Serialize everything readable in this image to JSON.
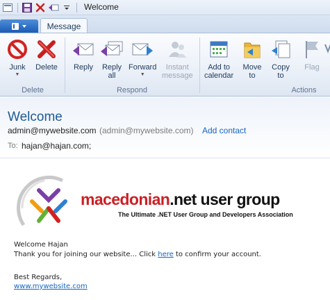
{
  "window": {
    "title": "Welcome"
  },
  "qat": {
    "icons": [
      "save-icon",
      "delete-icon",
      "reply-icon",
      "customize-arrow-icon"
    ]
  },
  "tabs": {
    "message": "Message"
  },
  "ribbon": {
    "groups": {
      "delete": "Delete",
      "respond": "Respond",
      "actions": "Actions"
    },
    "junk": "Junk",
    "delete": "Delete",
    "reply": "Reply",
    "reply_all_1": "Reply",
    "reply_all_2": "all",
    "forward": "Forward",
    "instant_1": "Instant",
    "instant_2": "message",
    "add_cal_1": "Add to",
    "add_cal_2": "calendar",
    "move_1": "Move",
    "move_2": "to",
    "copy_1": "Copy",
    "copy_2": "to",
    "flag": "Flag"
  },
  "header": {
    "subject": "Welcome",
    "from_email": "admin@mywebsite.com",
    "from_paren": "(admin@mywebsite.com)",
    "add_contact": "Add contact",
    "to_label": "To:",
    "to_value": "hajan@hajan.com;"
  },
  "message": {
    "brand_red": "macedonian",
    "brand_black": ".net user group",
    "tagline": "The Ultimate .NET User Group and Developers Association",
    "greeting": "Welcome Hajan",
    "line_pre": "Thank you for joining our website... Click ",
    "line_link": "here",
    "line_post": " to confirm your account.",
    "regards": "Best Regards,",
    "site_link": "www.mywebsite.com"
  },
  "colors": {
    "accent": "#1e5a96",
    "link": "#1565c0",
    "brand_red": "#cc1f24"
  }
}
